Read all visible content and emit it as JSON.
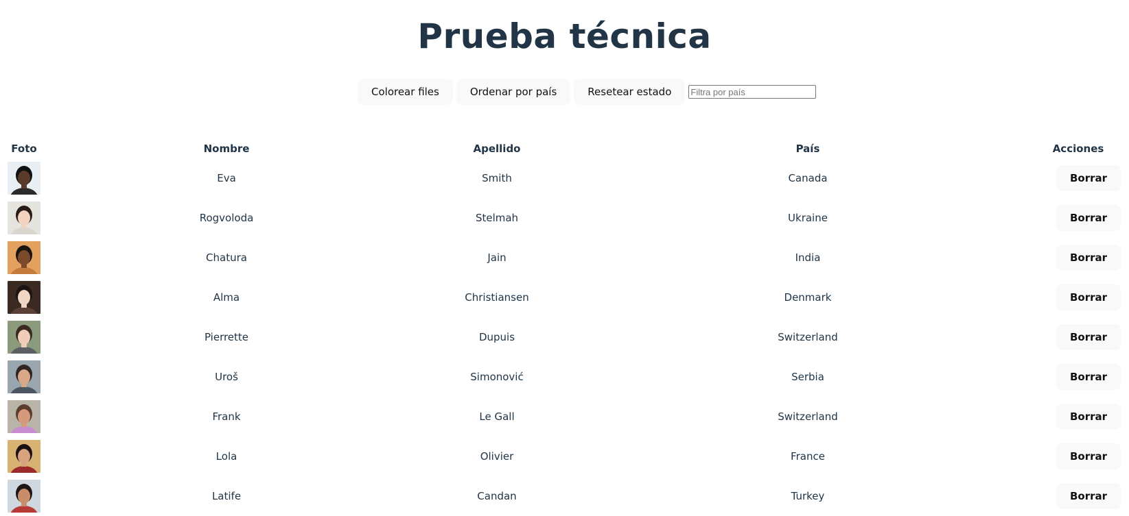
{
  "page": {
    "title": "Prueba técnica"
  },
  "toolbar": {
    "color_rows_label": "Colorear files",
    "sort_by_country_label": "Ordenar por país",
    "reset_state_label": "Resetear estado",
    "filter_placeholder": "Filtra por país",
    "filter_value": ""
  },
  "table": {
    "headers": {
      "photo": "Foto",
      "first_name": "Nombre",
      "last_name": "Apellido",
      "country": "País",
      "actions": "Acciones"
    },
    "delete_label": "Borrar",
    "rows": [
      {
        "first": "Eva",
        "last": "Smith",
        "country": "Canada",
        "avatar": {
          "bg": "#e9eef2",
          "skin": "#5a3b2a",
          "hair": "#111111",
          "shirt": "#2b2b2b"
        }
      },
      {
        "first": "Rogvoloda",
        "last": "Stelmah",
        "country": "Ukraine",
        "avatar": {
          "bg": "#e6e4df",
          "skin": "#f1d3bf",
          "hair": "#2a1d18",
          "shirt": "#d8d6cf"
        }
      },
      {
        "first": "Chatura",
        "last": "Jain",
        "country": "India",
        "avatar": {
          "bg": "#e3a15f",
          "skin": "#7a4a2b",
          "hair": "#1a1410",
          "shirt": "#c57b3a"
        }
      },
      {
        "first": "Alma",
        "last": "Christiansen",
        "country": "Denmark",
        "avatar": {
          "bg": "#3b2a22",
          "skin": "#f2d6c4",
          "hair": "#1b1412",
          "shirt": "#5a4036"
        }
      },
      {
        "first": "Pierrette",
        "last": "Dupuis",
        "country": "Switzerland",
        "avatar": {
          "bg": "#8a9a7a",
          "skin": "#efcdb8",
          "hair": "#3a2a22",
          "shirt": "#5b5f63"
        }
      },
      {
        "first": "Uroš",
        "last": "Simonović",
        "country": "Serbia",
        "avatar": {
          "bg": "#9aa6ad",
          "skin": "#d9a889",
          "hair": "#2f2521",
          "shirt": "#4d5560"
        }
      },
      {
        "first": "Frank",
        "last": "Le Gall",
        "country": "Switzerland",
        "avatar": {
          "bg": "#b9b4a8",
          "skin": "#d59a7c",
          "hair": "#5a3d2c",
          "shirt": "#c88bd0"
        }
      },
      {
        "first": "Lola",
        "last": "Olivier",
        "country": "France",
        "avatar": {
          "bg": "#d8b273",
          "skin": "#d7a27e",
          "hair": "#1a1212",
          "shirt": "#9b2b2b"
        }
      },
      {
        "first": "Latife",
        "last": "Candan",
        "country": "Turkey",
        "avatar": {
          "bg": "#cfd7df",
          "skin": "#c98d6b",
          "hair": "#201616",
          "shirt": "#b73a36"
        }
      }
    ]
  }
}
